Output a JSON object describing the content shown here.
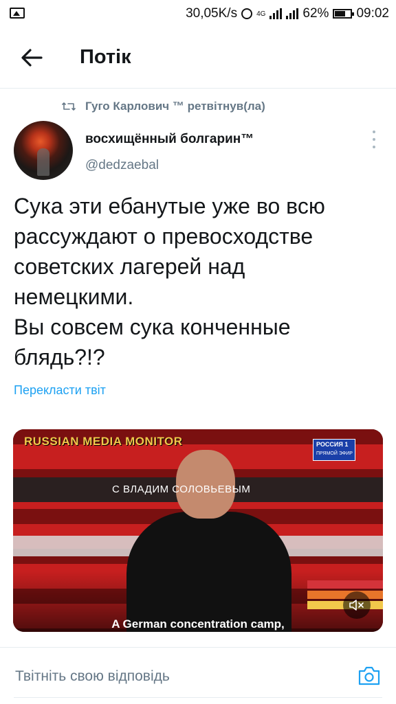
{
  "status_bar": {
    "speed": "30,05K/s",
    "network": "4G",
    "battery": "62%",
    "time": "09:02"
  },
  "header": {
    "title": "Потік"
  },
  "retweet": {
    "text": "Гуго Карлович ™ ретвітнув(ла)"
  },
  "tweet": {
    "display_name": "восхищённый болгарин™",
    "handle": "@dedzaebal",
    "text": "Сука эти ебанутые уже во всю\nрассуждают о превосходстве\nсоветских лагерей над\nнемецкими.\nВы совсем сука конченные\nблядь?!?",
    "translate_label": "Перекласти твіт"
  },
  "video": {
    "brand": "RUSSIAN MEDIA MONITOR",
    "banner": "С ВЛАДИМ    СОЛОВЬЕВЫМ",
    "logo_title": "РОССИЯ 1",
    "logo_sub": "ПРЯМОЙ ЭФИР",
    "caption": "A German concentration camp,"
  },
  "reply_bar": {
    "placeholder": "Твітніть свою відповідь"
  },
  "colors": {
    "accent": "#1da1f2",
    "secondary_text": "#657786",
    "divider": "#e6ecf0"
  }
}
